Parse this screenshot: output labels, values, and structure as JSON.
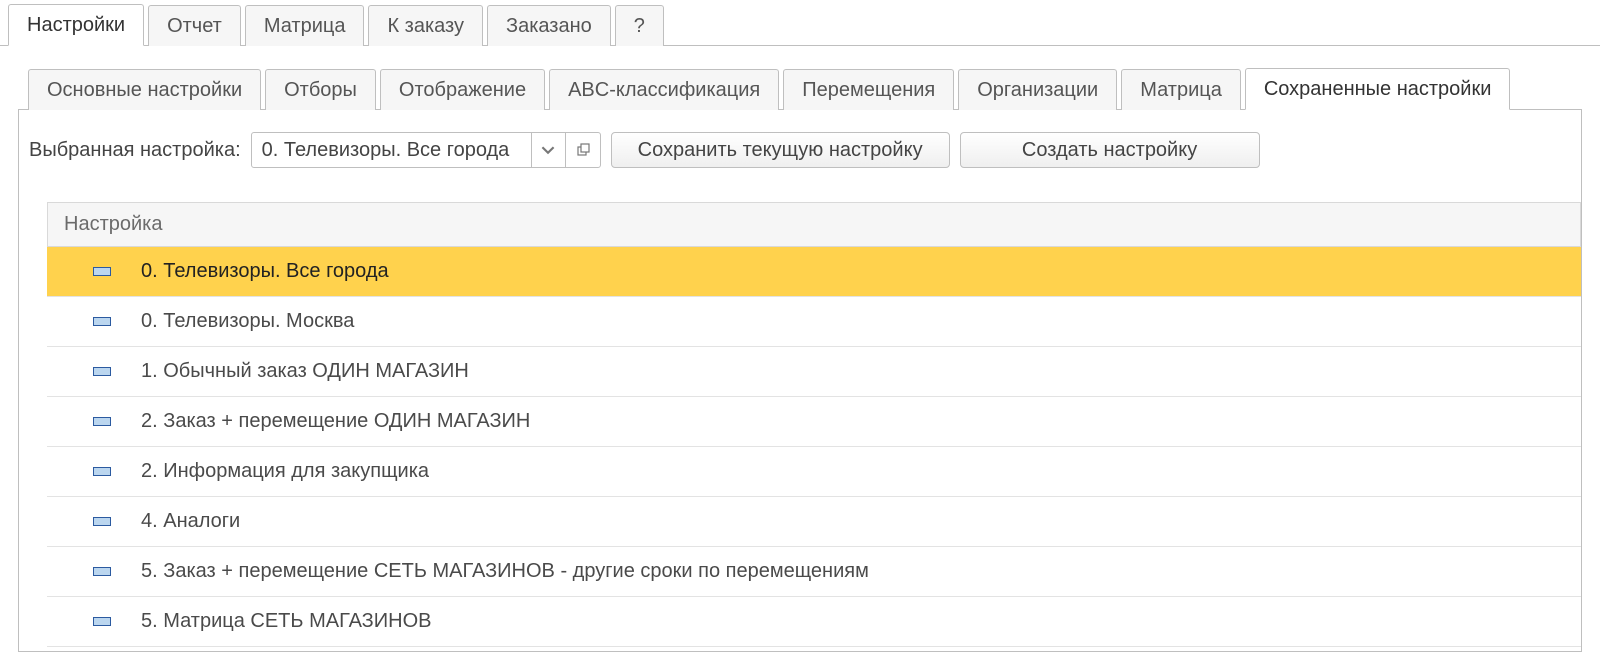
{
  "tabs_primary": [
    "Настройки",
    "Отчет",
    "Матрица",
    "К заказу",
    "Заказано",
    "?"
  ],
  "tabs_primary_active": 0,
  "tabs_secondary": [
    "Основные настройки",
    "Отборы",
    "Отображение",
    "ABC-классификация",
    "Перемещения",
    "Организации",
    "Матрица",
    "Сохраненные настройки"
  ],
  "tabs_secondary_active": 7,
  "toolbar": {
    "selected_label": "Выбранная настройка:",
    "selected_value": "0. Телевизоры. Все города",
    "save_label": "Сохранить текущую настройку",
    "create_label": "Создать настройку"
  },
  "list": {
    "header": "Настройка",
    "selected_index": 0,
    "items": [
      "0. Телевизоры. Все города",
      "0. Телевизоры. Москва",
      "1. Обычный заказ ОДИН МАГАЗИН",
      "2. Заказ + перемещение ОДИН МАГАЗИН",
      "2. Информация для закупщика",
      "4. Аналоги",
      "5. Заказ + перемещение СЕТЬ МАГАЗИНОВ - другие сроки по перемещениям",
      "5. Матрица СЕТЬ МАГАЗИНОВ"
    ]
  }
}
